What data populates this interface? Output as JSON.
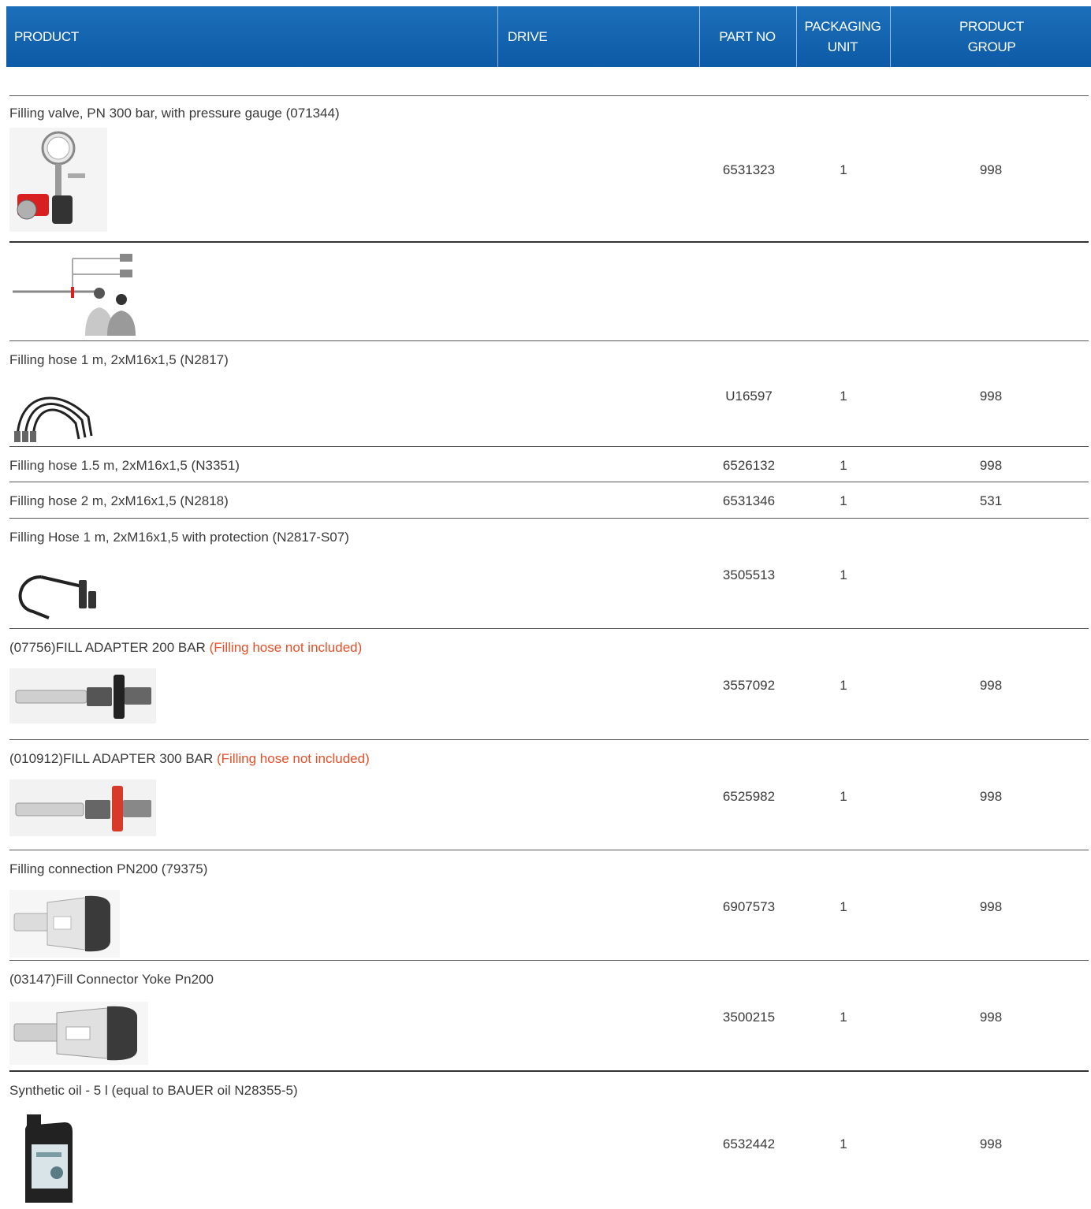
{
  "header": {
    "product": "PRODUCT",
    "drive": "DRIVE",
    "part_no": "PART NO",
    "packaging_unit_1": "PACKAGING",
    "packaging_unit_2": "UNIT",
    "product_group_1": "PRODUCT",
    "product_group_2": "GROUP"
  },
  "rows": [
    {
      "name": "Filling valve, PN 300 bar, with pressure gauge (071344)",
      "part_no": "6531323",
      "unit": "1",
      "group": "998",
      "image": "filling-valve-gauge"
    },
    {
      "name": "",
      "part_no": "",
      "unit": "",
      "group": "",
      "image": "filling-diagram"
    },
    {
      "name": "Filling hose 1 m, 2xM16x1,5 (N2817)",
      "part_no": "U16597",
      "unit": "1",
      "group": "998",
      "image": "filling-hoses"
    },
    {
      "name": "Filling hose 1.5 m, 2xM16x1,5 (N3351)",
      "part_no": "6526132",
      "unit": "1",
      "group": "998"
    },
    {
      "name": "Filling hose 2 m, 2xM16x1,5 (N2818)",
      "part_no": "6531346",
      "unit": "1",
      "group": "531"
    },
    {
      "name": "Filling Hose 1 m, 2xM16x1,5 with protection (N2817-S07)",
      "part_no": "3505513",
      "unit": "1",
      "group": "",
      "image": "hose-protection"
    },
    {
      "name": "(07756)FILL ADAPTER 200 BAR ",
      "note": "(Filling hose not included)",
      "part_no": "3557092",
      "unit": "1",
      "group": "998",
      "image": "adapter-200"
    },
    {
      "name": "(010912)FILL ADAPTER 300 BAR ",
      "note": "(Filling hose not included)",
      "part_no": "6525982",
      "unit": "1",
      "group": "998",
      "image": "adapter-300"
    },
    {
      "name": "Filling connection PN200 (79375)",
      "part_no": "6907573",
      "unit": "1",
      "group": "998",
      "image": "filling-connection"
    },
    {
      "name": "(03147)Fill Connector Yoke Pn200",
      "part_no": "3500215",
      "unit": "1",
      "group": "998",
      "image": "yoke-connector"
    },
    {
      "name": "Synthetic oil - 5 l (equal to BAUER oil N28355-5)",
      "part_no": "6532442",
      "unit": "1",
      "group": "998",
      "image": "oil-canister"
    }
  ]
}
